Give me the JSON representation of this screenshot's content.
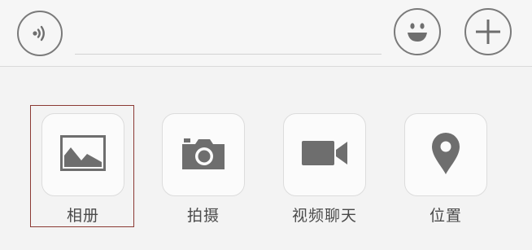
{
  "input_bar": {
    "voice_icon": "voice-wave-icon",
    "text_value": "",
    "emoji_icon": "smiley-face-icon",
    "plus_icon": "plus-icon"
  },
  "tools": [
    {
      "label": "相册",
      "icon": "photo-album-icon"
    },
    {
      "label": "拍摄",
      "icon": "camera-icon"
    },
    {
      "label": "视频聊天",
      "icon": "video-camera-icon"
    },
    {
      "label": "位置",
      "icon": "location-pin-icon"
    }
  ],
  "colors": {
    "icon_gray": "#6e6e6e",
    "highlight_border": "#8b3a34"
  }
}
